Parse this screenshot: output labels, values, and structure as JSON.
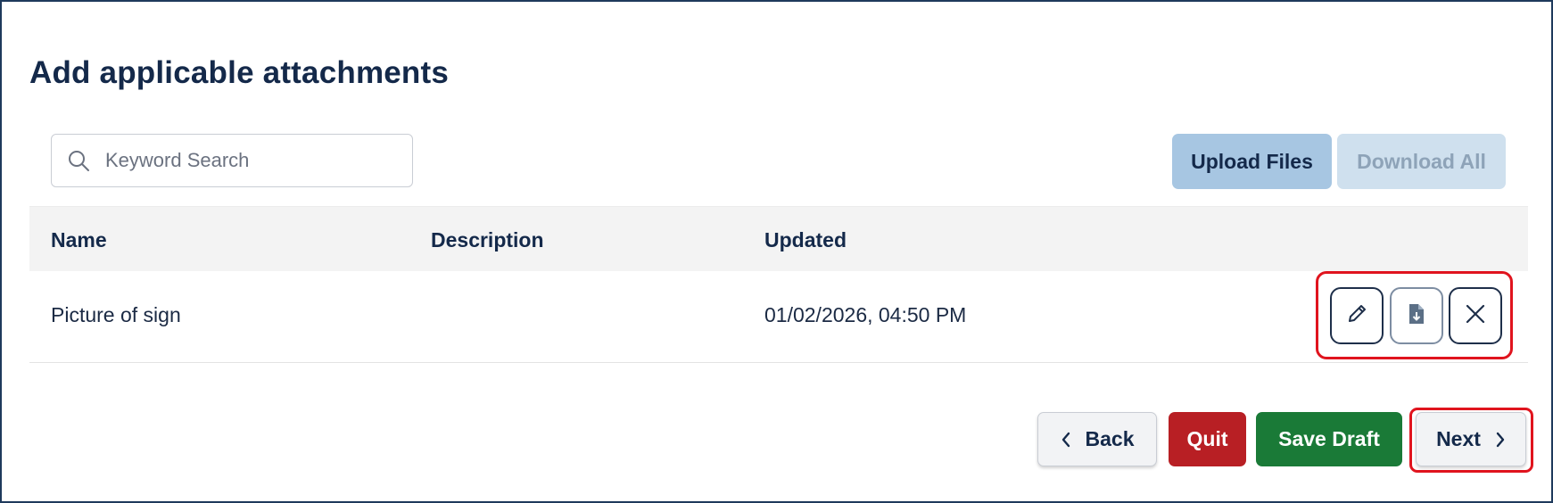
{
  "page": {
    "title": "Add applicable attachments"
  },
  "search": {
    "placeholder": "Keyword Search",
    "value": ""
  },
  "toolbar": {
    "upload_label": "Upload Files",
    "download_all_label": "Download All"
  },
  "table": {
    "columns": [
      "Name",
      "Description",
      "Updated"
    ],
    "rows": [
      {
        "name": "Picture of sign",
        "description": "",
        "updated": "01/02/2026, 04:50 PM"
      }
    ],
    "row_actions": [
      "pencil-icon",
      "file-download-icon",
      "close-icon"
    ]
  },
  "footer": {
    "back_label": "Back",
    "quit_label": "Quit",
    "save_draft_label": "Save Draft",
    "next_label": "Next"
  },
  "colors": {
    "title": "#14294a",
    "upload_bg": "#a7c6e2",
    "download_bg": "#cfe0ee",
    "quit_bg": "#b81f24",
    "save_bg": "#1a7a37",
    "highlight": "#e0141e"
  }
}
